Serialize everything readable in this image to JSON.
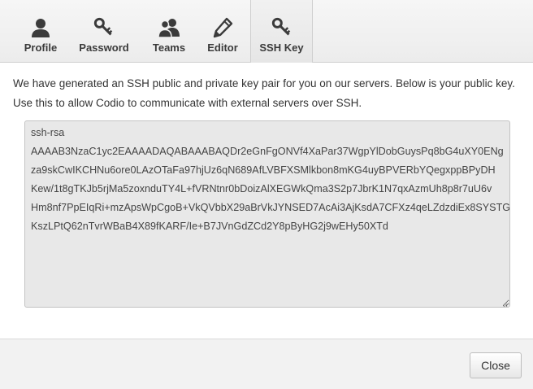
{
  "tabs": [
    {
      "label": "Profile",
      "icon": "user-icon",
      "active": false
    },
    {
      "label": "Password",
      "icon": "key-icon",
      "active": false
    },
    {
      "label": "Teams",
      "icon": "team-icon",
      "active": false
    },
    {
      "label": "Editor",
      "icon": "pen-icon",
      "active": false
    },
    {
      "label": "SSH Key",
      "icon": "key-icon",
      "active": true
    }
  ],
  "description": "We have generated an SSH public and private key pair for you on our servers. Below is your public key. Use this to allow Codio to communicate with external servers over SSH.",
  "key_lines": [
    "ssh-rsa",
    "AAAAB3NzaC1yc2EAAAADAQABAAABAQDr2eGnFgONVf4XaPar37WgpYlDobGuysPq8bG4uXY0ENg",
    "za9skCwIKCHNu6ore0LAzOTaFa97hjUz6qN689AfLVBFXSMlkbon8mKG4uyBPVERbYQegxppBPyDH",
    "Kew/1t8gTKJb5rjMa5zoxnduTY4L+fVRNtnr0bDoizAlXEGWkQma3S2p7JbrK1N7qxAzmUh8p8r7uU6v",
    "Hm8nf7PpEIqRi+mzApsWpCgoB+VkQVbbX29aBrVkJYNSED7AcAi3AjKsdA7CFXz4qeLZdzdiEx8SYSTG",
    "KszLPtQ62nTvrWBaB4X89fKARF/Ie+B7JVnGdZCd2Y8pByHG2j9wEHy50XTd"
  ],
  "footer": {
    "close_label": "Close"
  }
}
